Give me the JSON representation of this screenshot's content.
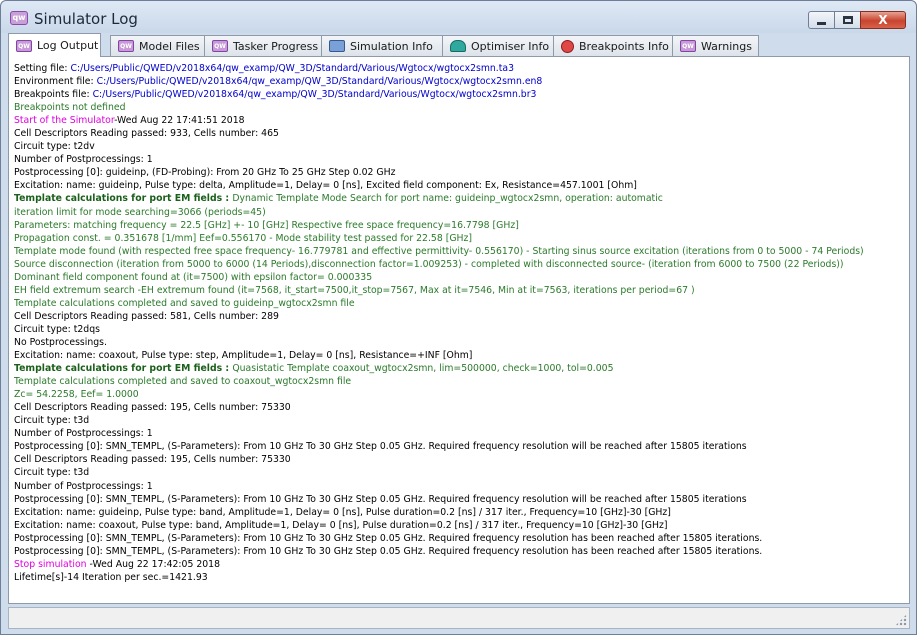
{
  "window": {
    "title": "Simulator Log",
    "app_icon": "qw",
    "minimize_icon": "minimize-icon",
    "maximize_icon": "maximize-icon",
    "close_label": "X"
  },
  "tabs": [
    {
      "label": "Log Output",
      "icon": "qw-icon",
      "active": true
    },
    {
      "label": "Model Files",
      "icon": "qw-icon",
      "active": false
    },
    {
      "label": "Tasker Progress",
      "icon": "qw-icon",
      "active": false
    },
    {
      "label": "Simulation Info",
      "icon": "info-icon",
      "active": false
    },
    {
      "label": "Optimiser Info",
      "icon": "optimiser-icon",
      "active": false
    },
    {
      "label": "Breakpoints Info",
      "icon": "breakpoint-icon",
      "active": false
    },
    {
      "label": "Warnings",
      "icon": "qw-icon",
      "active": false
    }
  ],
  "colors": {
    "path_blue": "#0000cc",
    "info_green": "#2b7a2b",
    "marker_magenta": "#e000e0",
    "heading_green": "#1a5f1a"
  },
  "log": [
    [
      {
        "t": "Setting file: ",
        "c": "black"
      },
      {
        "t": "C:/Users/Public/QWED/v2018x64/qw_examp/QW_3D/Standard/Various/Wgtocx/wgtocx2smn.ta3",
        "c": "blue"
      }
    ],
    [
      {
        "t": "Environment file: ",
        "c": "black"
      },
      {
        "t": "C:/Users/Public/QWED/v2018x64/qw_examp/QW_3D/Standard/Various/Wgtocx/wgtocx2smn.en8",
        "c": "blue"
      }
    ],
    [
      {
        "t": "Breakpoints file: ",
        "c": "black"
      },
      {
        "t": "C:/Users/Public/QWED/v2018x64/qw_examp/QW_3D/Standard/Various/Wgtocx/wgtocx2smn.br3",
        "c": "blue"
      }
    ],
    [
      {
        "t": "Breakpoints not defined",
        "c": "green"
      }
    ],
    [
      {
        "t": "Start of the Simulator",
        "c": "magenta"
      },
      {
        "t": "-Wed Aug 22 17:41:51 2018",
        "c": "black"
      }
    ],
    [
      {
        "t": "Cell Descriptors Reading passed: 933, Cells number: 465",
        "c": "black"
      }
    ],
    [
      {
        "t": "Circuit type: t2dv",
        "c": "black"
      }
    ],
    [
      {
        "t": "Number of Postprocessings: 1",
        "c": "black"
      }
    ],
    [
      {
        "t": "Postprocessing [0]: guideinp, (FD-Probing): From 20 GHz To 25 GHz Step 0.02 GHz",
        "c": "black"
      }
    ],
    [
      {
        "t": "Excitation: name: guideinp, Pulse type: delta, Amplitude=1, Delay= 0 [ns], Excited field component: Ex, Resistance=457.1001 [Ohm]",
        "c": "black"
      }
    ],
    [
      {
        "t": "Template calculations for port EM fields : ",
        "c": "heading"
      },
      {
        "t": "Dynamic Template Mode Search for port name: guideinp_wgtocx2smn, operation: automatic",
        "c": "green"
      }
    ],
    [
      {
        "t": "iteration limit for mode searching=3066 (periods=45)",
        "c": "green"
      }
    ],
    [
      {
        "t": "Parameters: matching frequency = 22.5 [GHz] +- 10 [GHz] Respective free space frequency=16.7798 [GHz]",
        "c": "green"
      }
    ],
    [
      {
        "t": "Propagation const. = 0.351678 [1/mm] Eef=0.556170 - Mode stability test passed for 22.58 [GHz]",
        "c": "green"
      }
    ],
    [
      {
        "t": "Template mode found (with respected free space frequency- 16.779781 and effective permittivity- 0.556170) - Starting sinus source excitation (iterations from 0 to 5000 - 74 Periods)",
        "c": "green"
      }
    ],
    [
      {
        "t": "Source disconnection (iteration from 5000 to 6000 (14 Periods),disconnection factor=1.009253) - completed with disconnected source- (iteration from 6000 to 7500 (22 Periods))",
        "c": "green"
      }
    ],
    [
      {
        "t": "Dominant field component found at (it=7500) with epsilon factor= 0.000335",
        "c": "green"
      }
    ],
    [
      {
        "t": "EH field extremum search -EH extremum found (it=7568, it_start=7500,it_stop=7567, Max at it=7546, Min at it=7563, iterations per period=67 )",
        "c": "green"
      }
    ],
    [
      {
        "t": "Template calculations completed and saved to guideinp_wgtocx2smn file",
        "c": "green"
      }
    ],
    [
      {
        "t": "Cell Descriptors Reading passed: 581, Cells number: 289",
        "c": "black"
      }
    ],
    [
      {
        "t": "Circuit type: t2dqs",
        "c": "black"
      }
    ],
    [
      {
        "t": "No Postprocessings.",
        "c": "black"
      }
    ],
    [
      {
        "t": "Excitation: name: coaxout, Pulse type: step, Amplitude=1, Delay= 0 [ns], Resistance=+INF [Ohm]",
        "c": "black"
      }
    ],
    [
      {
        "t": "Template calculations for port EM fields : ",
        "c": "heading"
      },
      {
        "t": "Quasistatic Template coaxout_wgtocx2smn, lim=500000, check=1000, tol=0.005",
        "c": "green"
      }
    ],
    [
      {
        "t": "Template calculations completed and saved to coaxout_wgtocx2smn file",
        "c": "green"
      }
    ],
    [
      {
        "t": "Zc= 54.2258, Eef= 1.0000",
        "c": "green"
      }
    ],
    [
      {
        "t": "Cell Descriptors Reading passed: 195, Cells number: 75330",
        "c": "black"
      }
    ],
    [
      {
        "t": "Circuit type: t3d",
        "c": "black"
      }
    ],
    [
      {
        "t": "Number of Postprocessings: 1",
        "c": "black"
      }
    ],
    [
      {
        "t": "Postprocessing [0]: SMN_TEMPL, (S-Parameters): From 10 GHz To 30 GHz Step 0.05 GHz. Required frequency resolution will be reached after 15805 iterations",
        "c": "black"
      }
    ],
    [
      {
        "t": "Cell Descriptors Reading passed: 195, Cells number: 75330",
        "c": "black"
      }
    ],
    [
      {
        "t": "Circuit type: t3d",
        "c": "black"
      }
    ],
    [
      {
        "t": "Number of Postprocessings: 1",
        "c": "black"
      }
    ],
    [
      {
        "t": "Postprocessing [0]: SMN_TEMPL, (S-Parameters): From 10 GHz To 30 GHz Step 0.05 GHz. Required frequency resolution will be reached after 15805 iterations",
        "c": "black"
      }
    ],
    [
      {
        "t": "Excitation: name: guideinp, Pulse type: band, Amplitude=1, Delay= 0 [ns], Pulse duration=0.2 [ns] / 317 iter., Frequency=10 [GHz]-30 [GHz]",
        "c": "black"
      }
    ],
    [
      {
        "t": "Excitation: name: coaxout, Pulse type: band, Amplitude=1, Delay= 0 [ns], Pulse duration=0.2 [ns] / 317 iter., Frequency=10 [GHz]-30 [GHz]",
        "c": "black"
      }
    ],
    [
      {
        "t": "Postprocessing [0]: SMN_TEMPL, (S-Parameters): From 10 GHz To 30 GHz Step 0.05 GHz. Required frequency resolution has been reached after 15805 iterations.",
        "c": "black"
      }
    ],
    [
      {
        "t": "Postprocessing [0]: SMN_TEMPL, (S-Parameters): From 10 GHz To 30 GHz Step 0.05 GHz. Required frequency resolution has been reached after 15805 iterations.",
        "c": "black"
      }
    ],
    [
      {
        "t": "Stop simulation",
        "c": "magenta"
      },
      {
        "t": " -Wed Aug 22 17:42:05 2018",
        "c": "black"
      }
    ],
    [
      {
        "t": "Lifetime[s]-14 Iteration per sec.=1421.93",
        "c": "black"
      }
    ]
  ]
}
